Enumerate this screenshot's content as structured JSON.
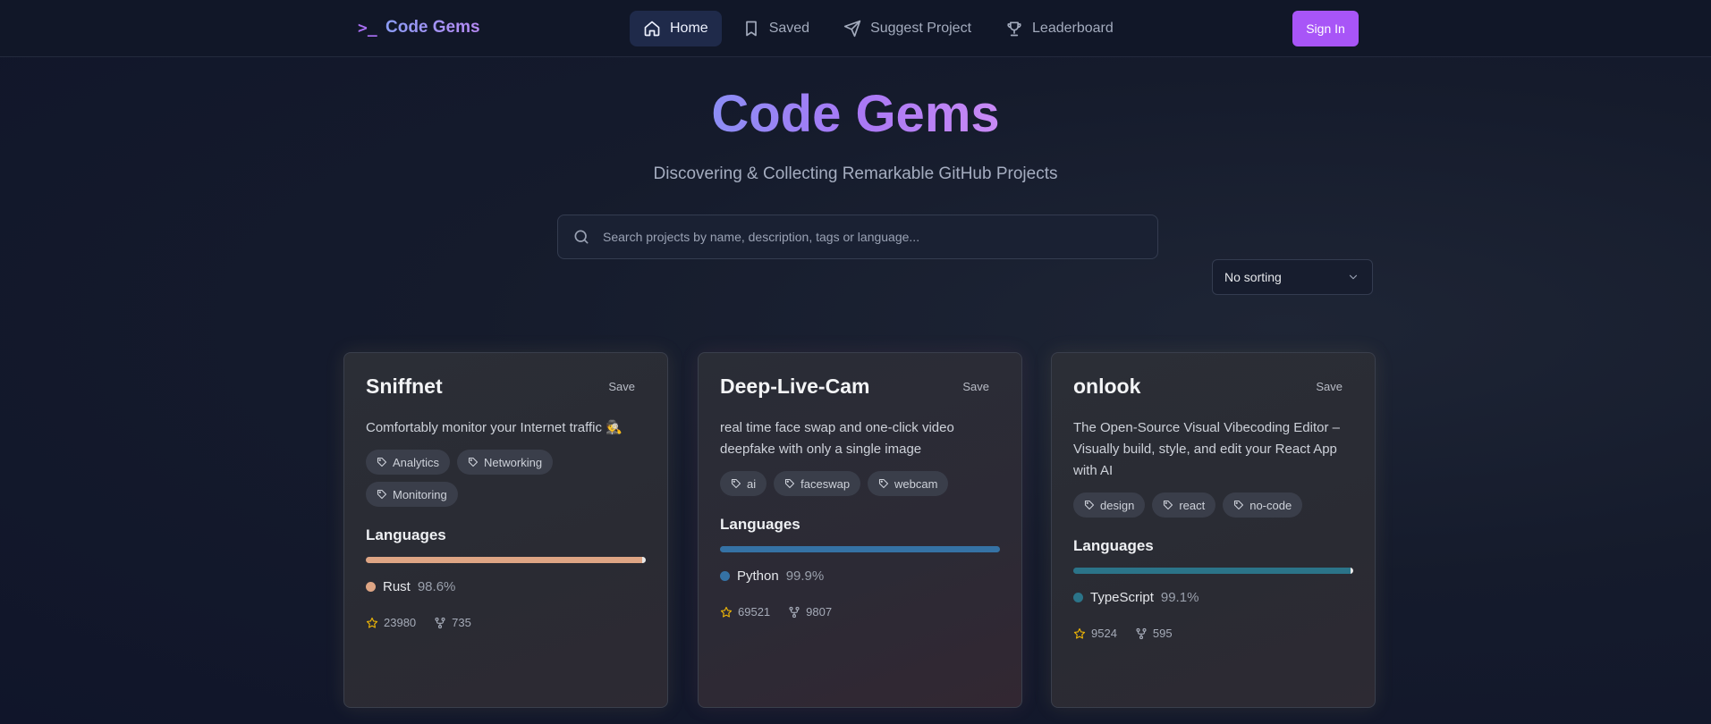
{
  "header": {
    "logo_icon": ">_",
    "logo_text": "Code Gems",
    "nav": [
      {
        "label": "Home",
        "icon": "home-icon",
        "active": true
      },
      {
        "label": "Saved",
        "icon": "bookmark-icon",
        "active": false
      },
      {
        "label": "Suggest Project",
        "icon": "send-icon",
        "active": false
      },
      {
        "label": "Leaderboard",
        "icon": "trophy-icon",
        "active": false
      }
    ],
    "sign_in_label": "Sign In"
  },
  "hero": {
    "title": "Code Gems",
    "subtitle": "Discovering & Collecting Remarkable GitHub Projects"
  },
  "search": {
    "placeholder": "Search projects by name, description, tags or language...",
    "value": ""
  },
  "sort": {
    "selected": "No sorting"
  },
  "languages_heading": "Languages",
  "cards": [
    {
      "title": "Sniffnet",
      "save_label": "Save",
      "description": "Comfortably monitor your Internet traffic 🕵️",
      "tags": [
        "Analytics",
        "Networking",
        "Monitoring"
      ],
      "language": {
        "name": "Rust",
        "percent": "98.6%",
        "fraction": 0.986,
        "color": "#dea584"
      },
      "stars": "23980",
      "forks": "735"
    },
    {
      "title": "Deep-Live-Cam",
      "save_label": "Save",
      "description": "real time face swap and one-click video deepfake with only a single image",
      "tags": [
        "ai",
        "faceswap",
        "webcam"
      ],
      "language": {
        "name": "Python",
        "percent": "99.9%",
        "fraction": 0.999,
        "color": "#3572a5"
      },
      "stars": "69521",
      "forks": "9807"
    },
    {
      "title": "onlook",
      "save_label": "Save",
      "description": "The Open-Source Visual Vibecoding Editor – Visually build, style, and edit your React App with AI",
      "tags": [
        "design",
        "react",
        "no-code"
      ],
      "language": {
        "name": "TypeScript",
        "percent": "99.1%",
        "fraction": 0.991,
        "color": "#2b7489"
      },
      "stars": "9524",
      "forks": "595"
    }
  ],
  "colors": {
    "accent": "#a855f7",
    "star": "#eab308"
  }
}
